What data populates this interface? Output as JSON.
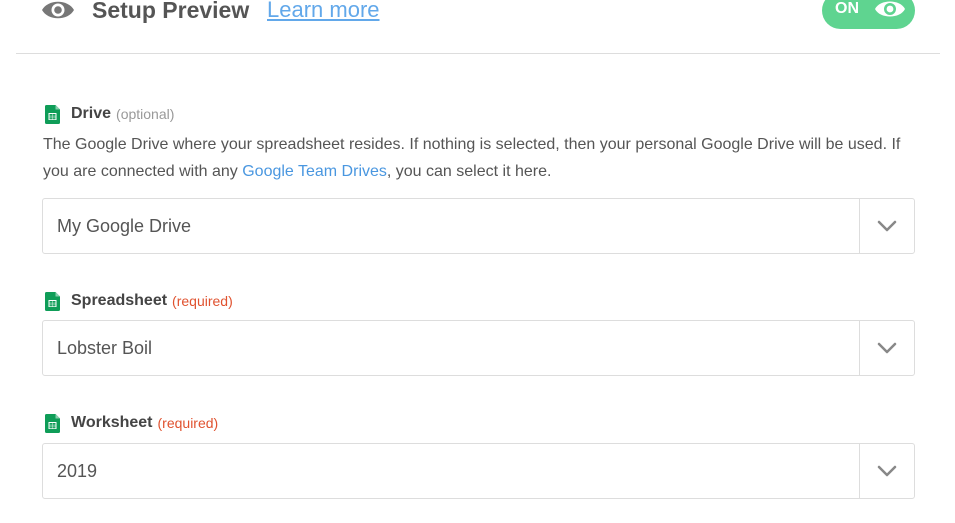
{
  "header": {
    "title": "Setup Preview",
    "learn_more": "Learn more",
    "toggle_label": "ON",
    "eye_icon": "eye-icon",
    "toggle_color": "#5fd490"
  },
  "fields": {
    "drive": {
      "label": "Drive",
      "tag": "(optional)",
      "help_before": "The Google Drive where your spreadsheet resides. If nothing is selected, then your personal Google Drive will be used. If you are connected with any ",
      "help_link": "Google Team Drives",
      "help_after": ", you can select it here.",
      "value": "My Google Drive",
      "icon": "google-sheets-icon"
    },
    "spreadsheet": {
      "label": "Spreadsheet",
      "tag": "(required)",
      "value": "Lobster Boil",
      "icon": "google-sheets-icon"
    },
    "worksheet": {
      "label": "Worksheet",
      "tag": "(required)",
      "value": "2019",
      "icon": "google-sheets-icon"
    }
  },
  "colors": {
    "link": "#62a8ea",
    "required": "#e0522f",
    "optional": "#999999",
    "sheets_green": "#0f9d58"
  }
}
